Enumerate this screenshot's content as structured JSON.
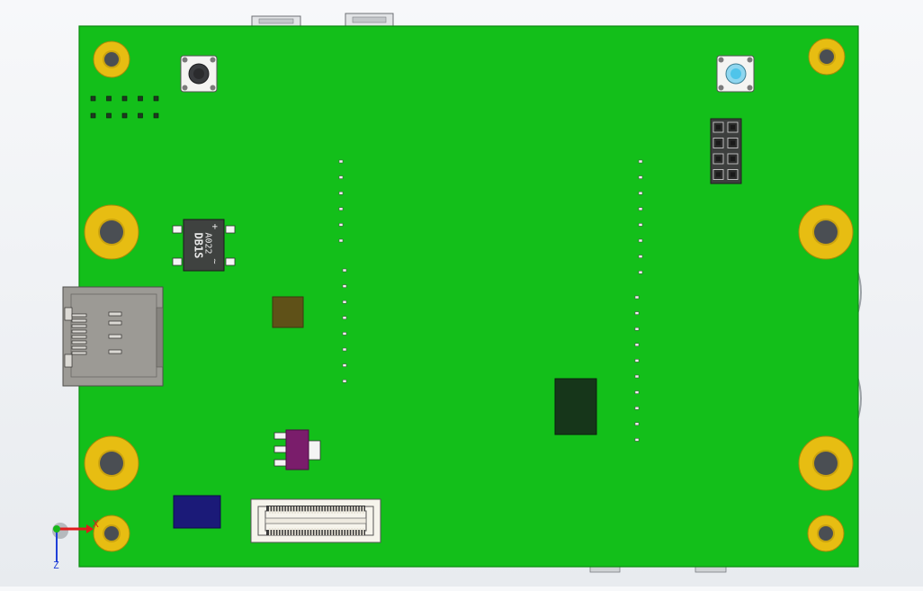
{
  "colors": {
    "pcb": "#13bf1a",
    "pcb_edge": "#0c8a12",
    "mount_ring": "#e7bd12",
    "mount_hole": "#4a4e53",
    "chip_dark_green": "#16361a",
    "chip_olive": "#5f5118",
    "regulator": "#7a1d6b",
    "chip_navy": "#1b1a78",
    "sd_slot": "#9c9a95",
    "axis_x": "#e01c1c",
    "axis_y": "#17b81a",
    "axis_z": "#1f3fd8"
  },
  "bridge_rectifier": {
    "line1": "A022",
    "line2": "DB1S"
  },
  "axes": {
    "x_label": "X",
    "z_label": "Z"
  },
  "components": [
    {
      "name": "tact-switch-left",
      "icon": "push-button-icon"
    },
    {
      "name": "tact-switch-right",
      "icon": "push-button-icon"
    },
    {
      "name": "pin-header-2x4",
      "icon": "header-icon"
    },
    {
      "name": "micro-sd-slot",
      "icon": "card-slot-icon"
    },
    {
      "name": "fpc-connector",
      "icon": "connector-icon"
    }
  ]
}
